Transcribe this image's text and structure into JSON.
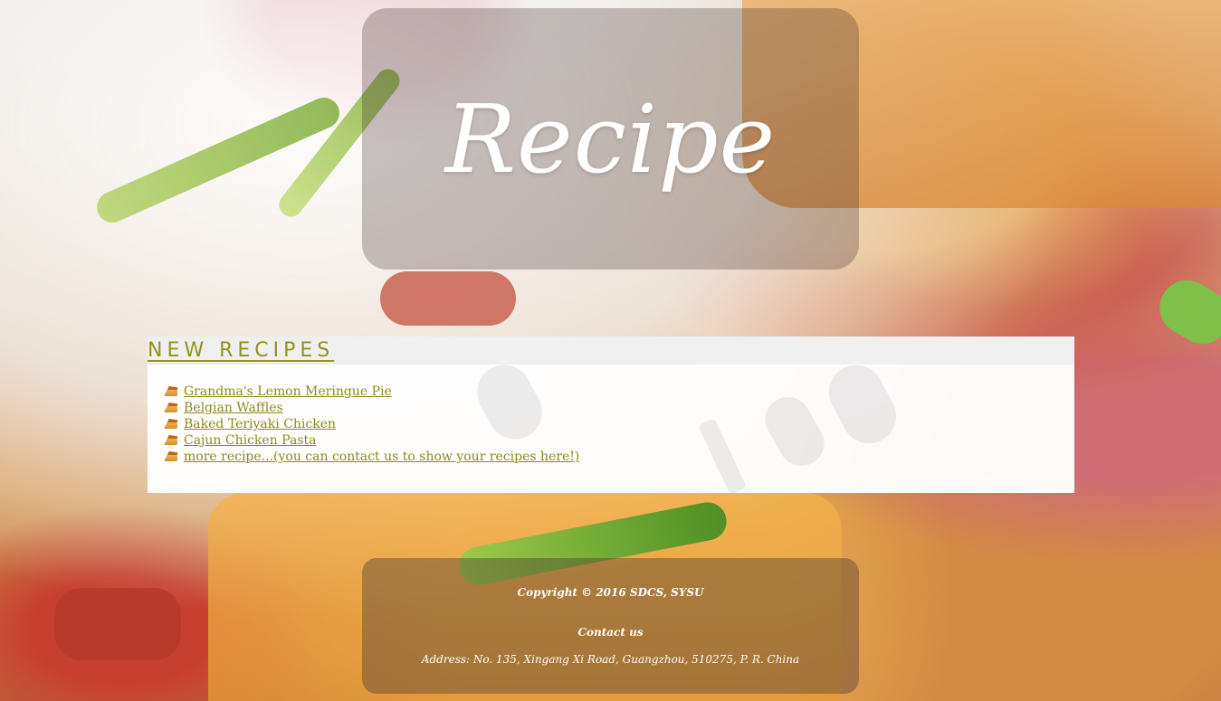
{
  "header": {
    "title": "Recipe"
  },
  "new_recipes": {
    "heading": "NEW RECIPES",
    "items": [
      {
        "label": "Grandma's Lemon Meringue Pie",
        "icon": "pie-icon"
      },
      {
        "label": "Belgian Waffles",
        "icon": "pie-icon"
      },
      {
        "label": "Baked Teriyaki Chicken",
        "icon": "pie-icon"
      },
      {
        "label": "Cajun Chicken Pasta",
        "icon": "pie-icon"
      },
      {
        "label": "more recipe...(you can contact us to show your recipes here!)",
        "icon": "pie-icon"
      }
    ]
  },
  "footer": {
    "copyright": "Copyright © 2016 SDCS, SYSU",
    "contact_label": "Contact us",
    "address": "Address: No. 135, Xingang Xi Road, Guangzhou, 510275, P. R. China"
  },
  "colors": {
    "link": "#8c8a1a",
    "heading": "#94921c",
    "panel_text": "#ffffff"
  }
}
